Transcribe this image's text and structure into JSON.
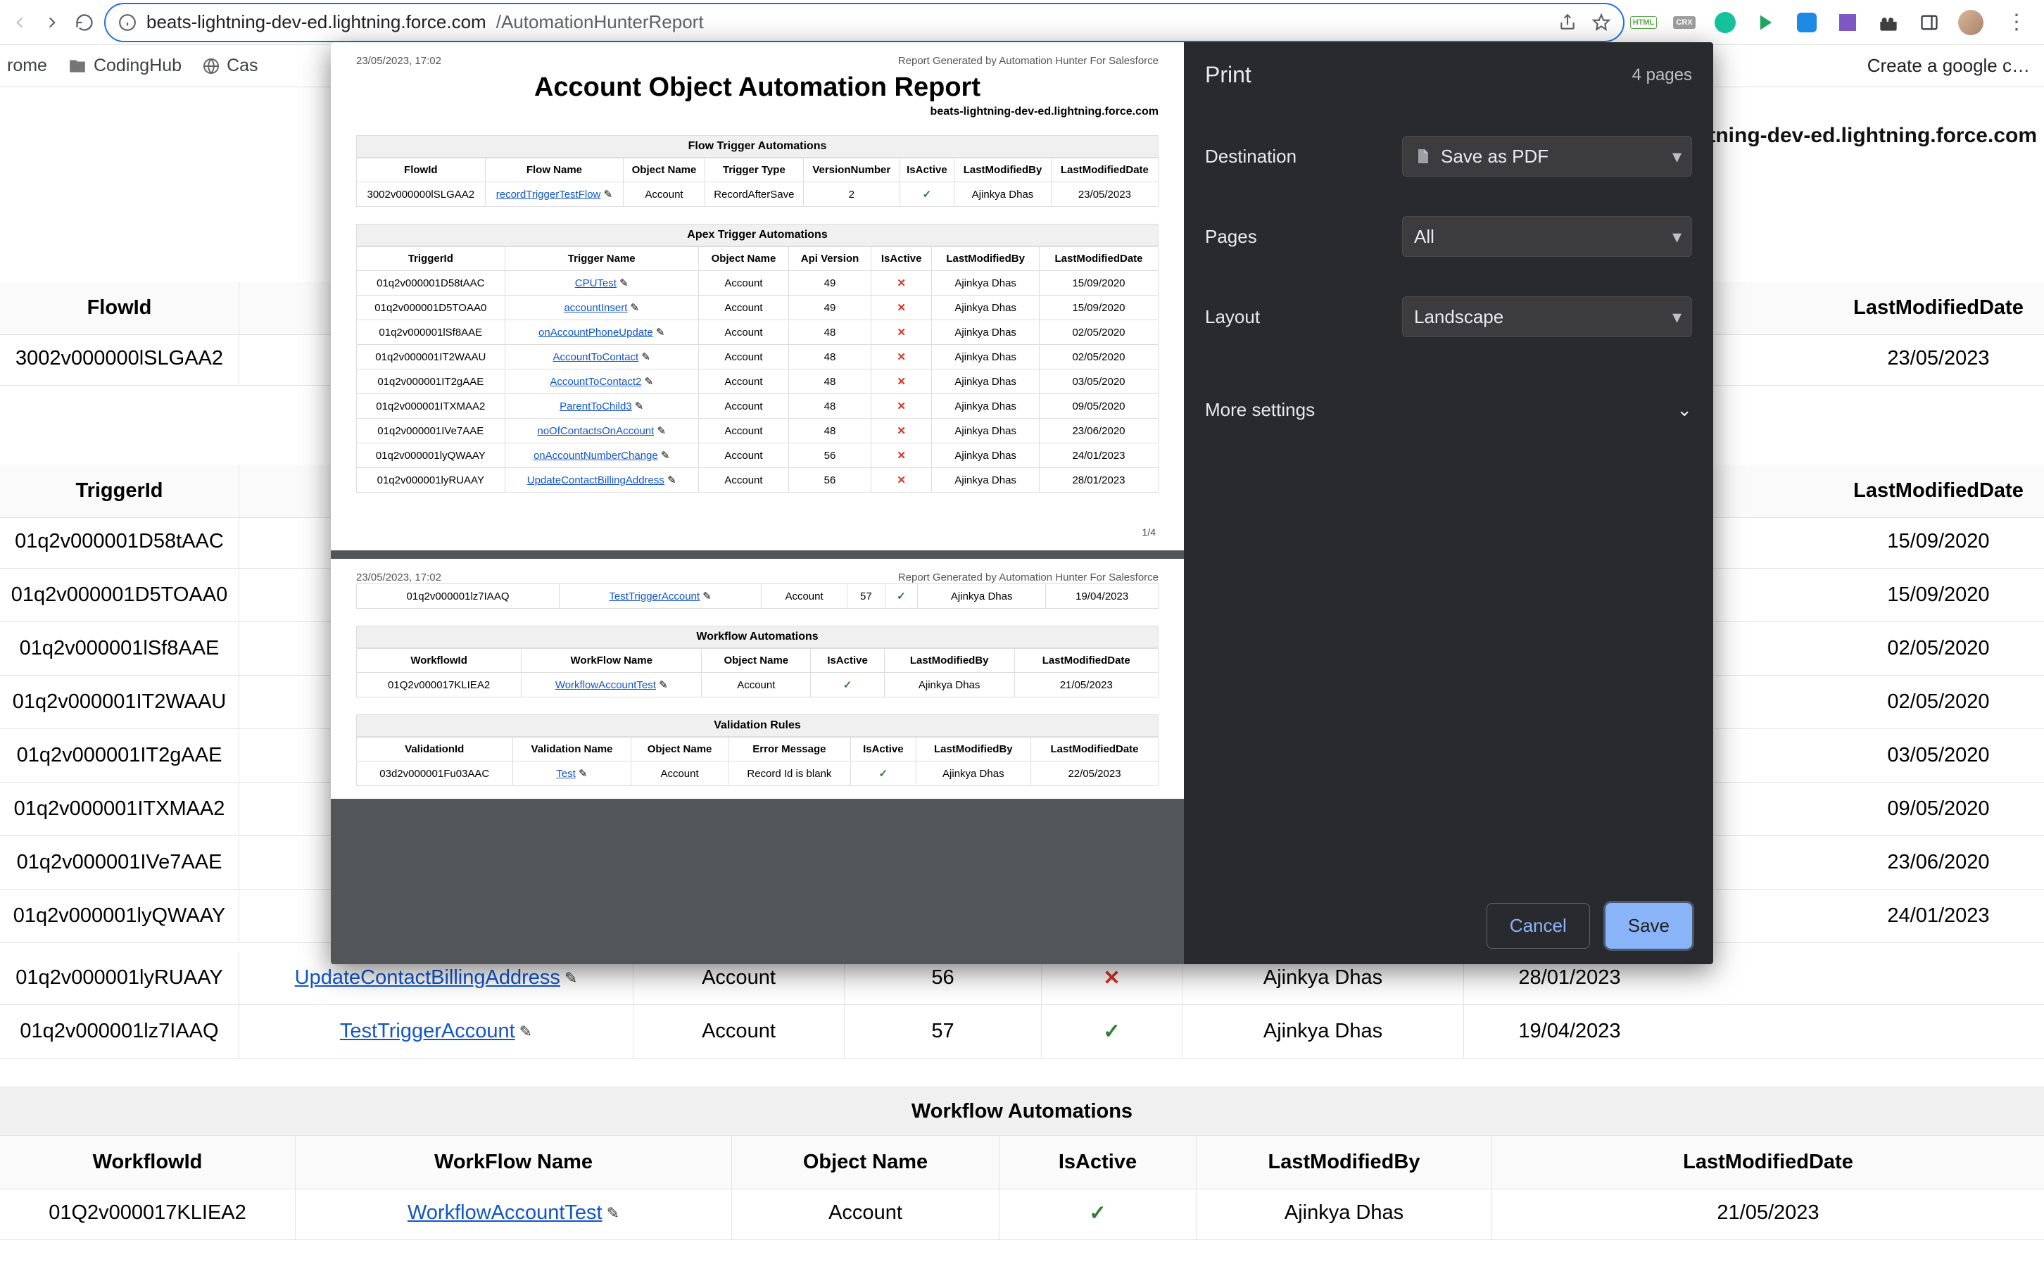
{
  "browser": {
    "url_host": "beats-lightning-dev-ed.lightning.force.com",
    "url_path": "/AutomationHunterReport",
    "bookmarks": {
      "b0": "rome",
      "b1": "CodingHub",
      "b2": "Cas",
      "right": "Create a google c…"
    }
  },
  "bg": {
    "host_echo": "-lightning-dev-ed.lightning.force.com",
    "flow_headers": {
      "flowid": "FlowId",
      "lmd": "LastModifiedDate"
    },
    "flow_rows": [
      {
        "id": "3002v000000lSLGAA2",
        "lmd": "23/05/2023"
      }
    ],
    "apex_headers": {
      "trgid": "TriggerId",
      "lmd": "LastModifiedDate"
    },
    "apex_rows": [
      {
        "id": "01q2v000001D58tAAC",
        "lmd": "15/09/2020"
      },
      {
        "id": "01q2v000001D5TOAA0",
        "lmd": "15/09/2020"
      },
      {
        "id": "01q2v000001lSf8AAE",
        "lmd": "02/05/2020"
      },
      {
        "id": "01q2v000001IT2WAAU",
        "lmd": "02/05/2020"
      },
      {
        "id": "01q2v000001IT2gAAE",
        "lmd": "03/05/2020"
      },
      {
        "id": "01q2v000001ITXMAA2",
        "lmd": "09/05/2020"
      },
      {
        "id": "01q2v000001IVe7AAE",
        "lmd": "23/06/2020"
      },
      {
        "id": "01q2v000001lyQWAAY",
        "lmd": "24/01/2023"
      },
      {
        "id": "01q2v000001lyRUAAY",
        "lmd": "28/01/2023"
      },
      {
        "id": "01q2v000001lz7IAAQ",
        "lmd": "19/04/2023"
      }
    ],
    "apex_last_visible": {
      "name": "UpdateContactBillingAddress",
      "obj": "Account",
      "ver": "56",
      "active": "x",
      "lmb": "Ajinkya Dhas"
    },
    "apex_tt_visible": {
      "name": "TestTriggerAccount",
      "obj": "Account",
      "ver": "57",
      "active": "check",
      "lmb": "Ajinkya Dhas"
    },
    "wf_section": "Workflow Automations",
    "wf_headers": {
      "wfid": "WorkflowId",
      "wfname": "WorkFlow Name",
      "obj": "Object Name",
      "active": "IsActive",
      "lmb": "LastModifiedBy",
      "lmd": "LastModifiedDate"
    },
    "wf_rows": [
      {
        "id": "01Q2v000017KLIEA2",
        "name": "WorkflowAccountTest",
        "obj": "Account",
        "active": "check",
        "lmb": "Ajinkya Dhas",
        "lmd": "21/05/2023"
      }
    ]
  },
  "print": {
    "title": "Print",
    "page_count": "4 pages",
    "destination_label": "Destination",
    "destination_value": "Save as PDF",
    "pages_label": "Pages",
    "pages_value": "All",
    "layout_label": "Layout",
    "layout_value": "Landscape",
    "more_settings": "More settings",
    "cancel": "Cancel",
    "save": "Save"
  },
  "preview": {
    "timestamp": "23/05/2023, 17:02",
    "generator": "Report Generated by Automation Hunter For Salesforce",
    "report_title": "Account Object Automation Report",
    "host": "beats-lightning-dev-ed.lightning.force.com",
    "pagefoot": "1/4",
    "sections": {
      "flow_title": "Flow Trigger Automations",
      "apex_title": "Apex Trigger Automations",
      "wf_title": "Workflow Automations",
      "val_title": "Validation Rules"
    },
    "flow": {
      "headers": [
        "FlowId",
        "Flow Name",
        "Object Name",
        "Trigger Type",
        "VersionNumber",
        "IsActive",
        "LastModifiedBy",
        "LastModifiedDate"
      ],
      "rows": [
        {
          "id": "3002v000000lSLGAA2",
          "name": "recordTriggerTestFlow",
          "obj": "Account",
          "ttype": "RecordAfterSave",
          "ver": "2",
          "active": "check",
          "lmb": "Ajinkya Dhas",
          "lmd": "23/05/2023"
        }
      ]
    },
    "apex": {
      "headers": [
        "TriggerId",
        "Trigger Name",
        "Object Name",
        "Api Version",
        "IsActive",
        "LastModifiedBy",
        "LastModifiedDate"
      ],
      "rows": [
        {
          "id": "01q2v000001D58tAAC",
          "name": "CPUTest",
          "obj": "Account",
          "ver": "49",
          "active": "x",
          "lmb": "Ajinkya Dhas",
          "lmd": "15/09/2020"
        },
        {
          "id": "01q2v000001D5TOAA0",
          "name": "accountInsert",
          "obj": "Account",
          "ver": "49",
          "active": "x",
          "lmb": "Ajinkya Dhas",
          "lmd": "15/09/2020"
        },
        {
          "id": "01q2v000001lSf8AAE",
          "name": "onAccountPhoneUpdate",
          "obj": "Account",
          "ver": "48",
          "active": "x",
          "lmb": "Ajinkya Dhas",
          "lmd": "02/05/2020"
        },
        {
          "id": "01q2v000001IT2WAAU",
          "name": "AccountToContact",
          "obj": "Account",
          "ver": "48",
          "active": "x",
          "lmb": "Ajinkya Dhas",
          "lmd": "02/05/2020"
        },
        {
          "id": "01q2v000001IT2gAAE",
          "name": "AccountToContact2",
          "obj": "Account",
          "ver": "48",
          "active": "x",
          "lmb": "Ajinkya Dhas",
          "lmd": "03/05/2020"
        },
        {
          "id": "01q2v000001ITXMAA2",
          "name": "ParentToChild3",
          "obj": "Account",
          "ver": "48",
          "active": "x",
          "lmb": "Ajinkya Dhas",
          "lmd": "09/05/2020"
        },
        {
          "id": "01q2v000001IVe7AAE",
          "name": "noOfContactsOnAccount",
          "obj": "Account",
          "ver": "48",
          "active": "x",
          "lmb": "Ajinkya Dhas",
          "lmd": "23/06/2020"
        },
        {
          "id": "01q2v000001lyQWAAY",
          "name": "onAccountNumberChange",
          "obj": "Account",
          "ver": "56",
          "active": "x",
          "lmb": "Ajinkya Dhas",
          "lmd": "24/01/2023"
        },
        {
          "id": "01q2v000001lyRUAAY",
          "name": "UpdateContactBillingAddress",
          "obj": "Account",
          "ver": "56",
          "active": "x",
          "lmb": "Ajinkya Dhas",
          "lmd": "28/01/2023"
        }
      ]
    },
    "apex_page2_row": {
      "id": "01q2v000001lz7IAAQ",
      "name": "TestTriggerAccount",
      "obj": "Account",
      "ver": "57",
      "active": "check",
      "lmb": "Ajinkya Dhas",
      "lmd": "19/04/2023"
    },
    "wf": {
      "headers": [
        "WorkflowId",
        "WorkFlow Name",
        "Object Name",
        "IsActive",
        "LastModifiedBy",
        "LastModifiedDate"
      ],
      "rows": [
        {
          "id": "01Q2v000017KLIEA2",
          "name": "WorkflowAccountTest",
          "obj": "Account",
          "active": "check",
          "lmb": "Ajinkya Dhas",
          "lmd": "21/05/2023"
        }
      ]
    },
    "val": {
      "headers": [
        "ValidationId",
        "Validation Name",
        "Object Name",
        "Error Message",
        "IsActive",
        "LastModifiedBy",
        "LastModifiedDate"
      ],
      "rows": [
        {
          "id": "03d2v000001Fu03AAC",
          "name": "Test",
          "obj": "Account",
          "err": "Record Id is blank",
          "active": "check",
          "lmb": "Ajinkya Dhas",
          "lmd": "22/05/2023"
        }
      ]
    }
  }
}
